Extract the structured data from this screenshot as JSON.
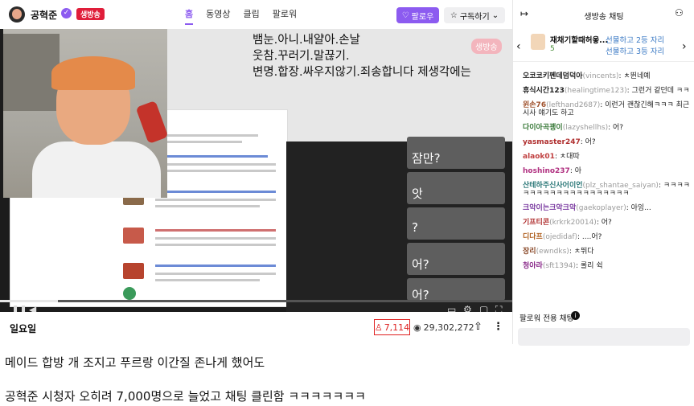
{
  "channel": {
    "name": "공혁준",
    "live_badge": "생방송"
  },
  "tabs": [
    {
      "label": "홈",
      "active": true
    },
    {
      "label": "동영상",
      "active": false
    },
    {
      "label": "클립",
      "active": false
    },
    {
      "label": "팔로워",
      "active": false
    }
  ],
  "buttons": {
    "follow": "팔로우",
    "subscribe": "구독하기"
  },
  "overlay_text": [
    "뱀눈.아니.내얄아.손날",
    "웃참.꾸러기.말끊기.",
    "변명.합장.싸우지않기.죄송합니다 제생각에는"
  ],
  "overlay_live_tag": "생방송",
  "video_chat": [
    {
      "msg": "잠만?"
    },
    {
      "msg": "앗"
    },
    {
      "msg": "?"
    },
    {
      "msg": "어?"
    },
    {
      "msg": "어?"
    }
  ],
  "video_title": "일요일",
  "viewer_count": "7,114",
  "total_views": "29,302,272",
  "chat_panel": {
    "title": "생방송 채팅",
    "gift": {
      "text": "재채기할때허읗...",
      "count": "5",
      "line_a": "선물하고 2등 자리",
      "line_b": "선물하고 3등 자리"
    },
    "messages": [
      {
        "nick": "오코코키펜데덤덕아",
        "uid": "(vincents)",
        "text": ": ㅊ뛴네예"
      },
      {
        "nick": "휴식시간123",
        "uid": "(healingtime123)",
        "text": ": 그런거 같던데 ㅋㅋ"
      },
      {
        "nick": "윈손76",
        "uid": "(lefthand2687)",
        "text": ": 이런거 괜찮긴해ㅋㅋㅋ 최근 시사 얘기도 하고"
      },
      {
        "nick": "다이아곡괭이",
        "uid": "(lazyshellhs)",
        "text": ": 어?"
      },
      {
        "nick": "yasmaster247",
        "uid": "",
        "text": ": 어?"
      },
      {
        "nick": "alaok01",
        "uid": "",
        "text": ": ㅊ대따"
      },
      {
        "nick": "hoshino237",
        "uid": "",
        "text": ": 아"
      },
      {
        "nick": "산테하주신사어이언",
        "uid": "(plz_shantae_saiyan)",
        "text": ": ㅋㅋㅋㅋㅋㅋㅋㅋㅋㅋㅋㅋㅋㅋㅋㅋㅋㅋㅋㅋ"
      },
      {
        "nick": "크악이는크악크악",
        "uid": "(gaekoplayer)",
        "text": ": 아잉..."
      },
      {
        "nick": "기프티콘",
        "uid": "(krkrk20014)",
        "text": ": 어?"
      },
      {
        "nick": "디다프",
        "uid": "(ojedidaf)",
        "text": ": ....어?"
      },
      {
        "nick": "장리",
        "uid": "(ewndks)",
        "text": ": ㅊ뛰다"
      },
      {
        "nick": "청아라",
        "uid": "(sft1394)",
        "text": ": 롤리 쉭"
      }
    ],
    "follower_only": "팔로워 전용 채팅"
  },
  "captions": [
    "메이드 합방 개 조지고 푸르랑 이간질 존나게 했어도",
    "공혁준 시청자 오히려 7,000명으로 늘었고 채팅 클린함 ㅋㅋㅋㅋㅋㅋㅋ"
  ],
  "colors": {
    "accent": "#8c5bf0",
    "live": "#e01e3a",
    "highlight_box": "#e02020"
  }
}
